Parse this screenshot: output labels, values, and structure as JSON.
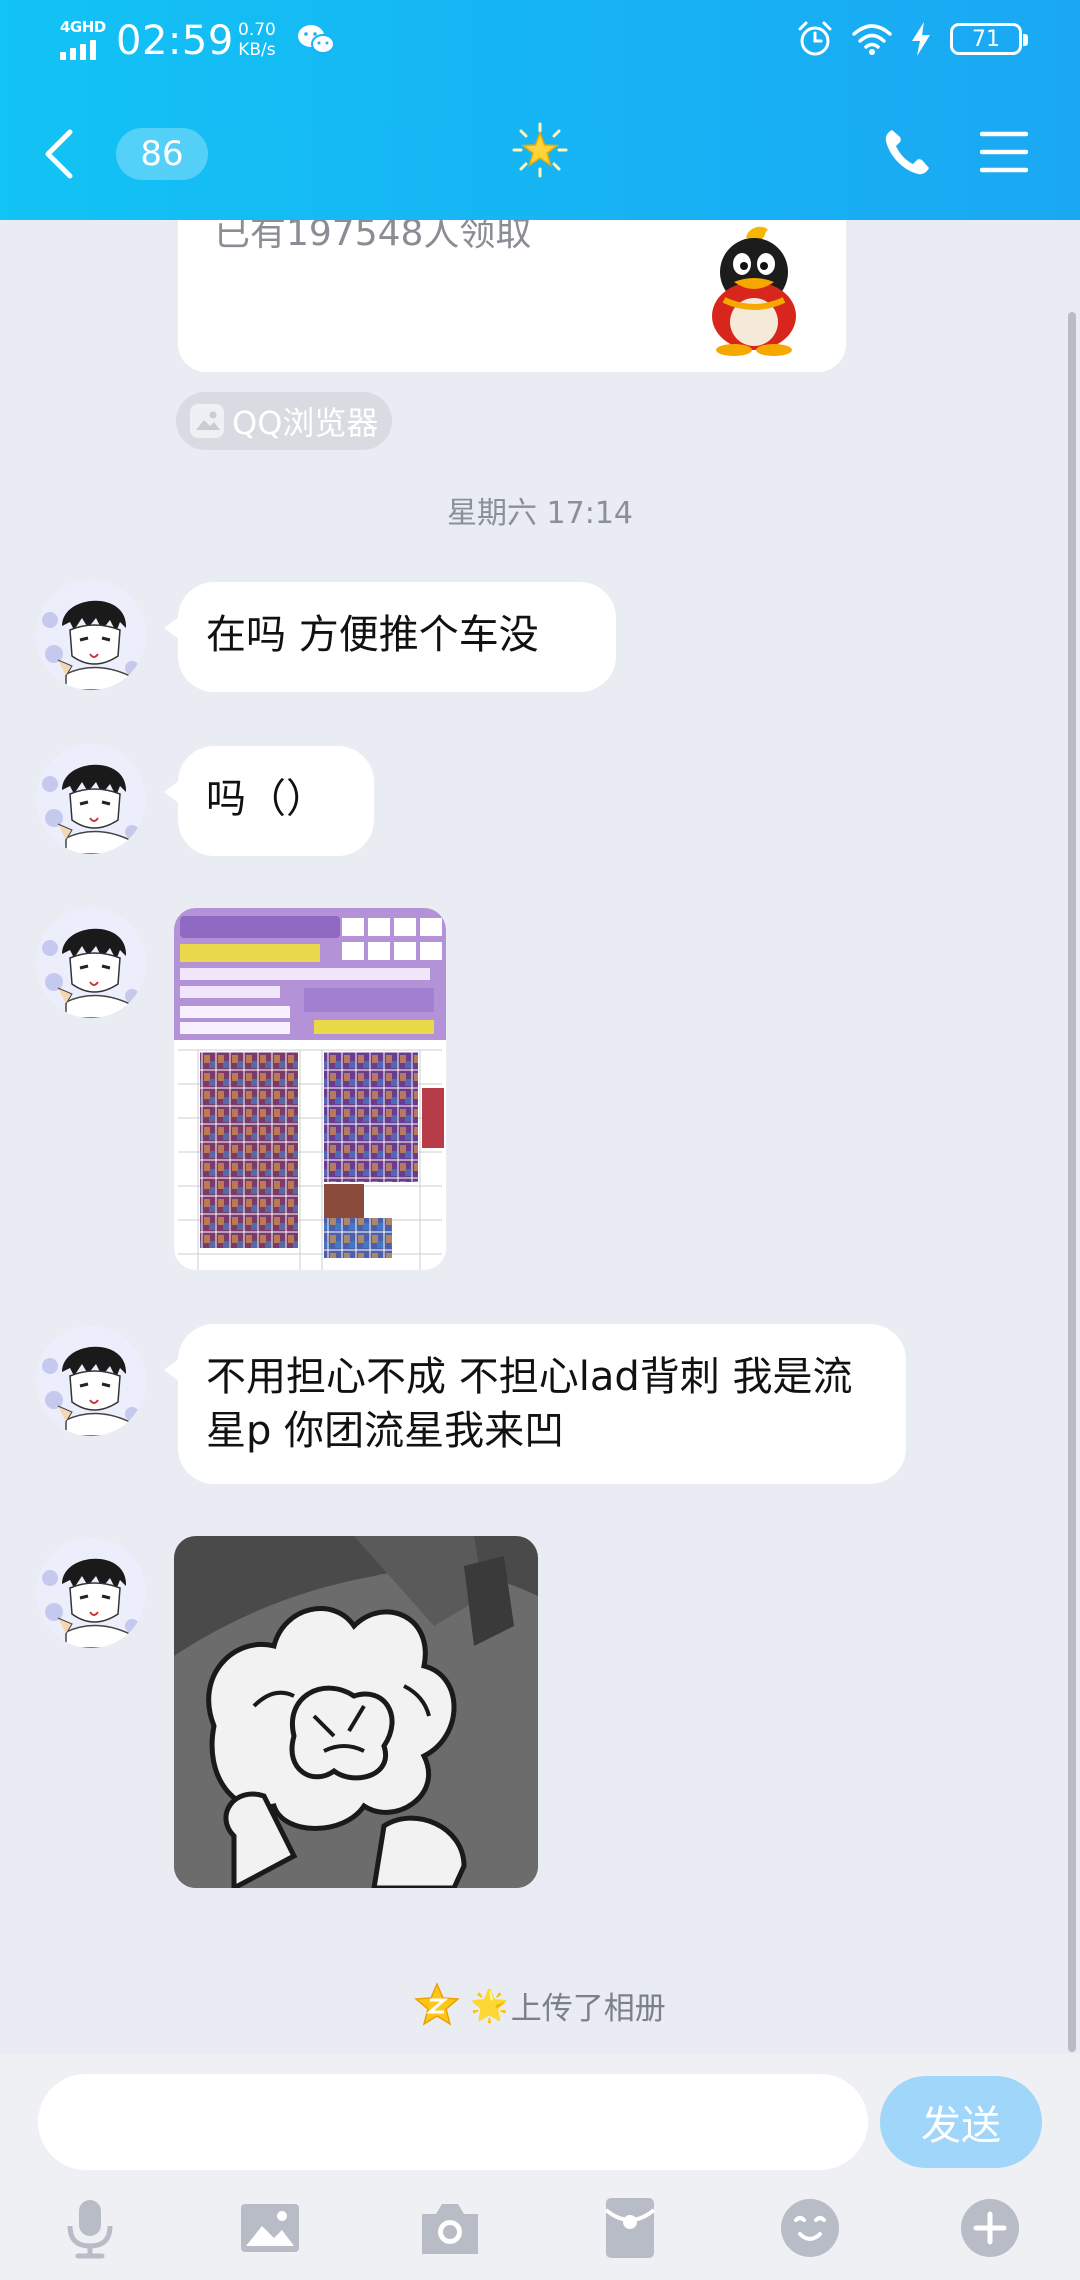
{
  "status_bar": {
    "network": "4GHD",
    "time": "02:59",
    "speed_value": "0.70",
    "speed_unit": "KB/s",
    "battery": "71"
  },
  "navbar": {
    "unread_count": "86",
    "title_icon": "star-emoji"
  },
  "chat": {
    "share_card": {
      "subtitle": "已有197548人领取"
    },
    "source_label": "QQ浏览器",
    "timestamp": "星期六 17:14",
    "messages": [
      {
        "type": "text",
        "text": "在吗 方便推个车没"
      },
      {
        "type": "text",
        "text": "吗（）"
      },
      {
        "type": "image",
        "description_icon": "poster-image"
      },
      {
        "type": "text",
        "text": "不用担心不成 不担心lad背刺 我是流星p 你团流星我来凹"
      },
      {
        "type": "image",
        "description_icon": "sticker-image"
      }
    ],
    "album_notice": {
      "star": "🌟",
      "text": "上传了相册"
    }
  },
  "input": {
    "placeholder": "",
    "send_label": "发送"
  },
  "colors": {
    "header": "#16b6f4",
    "background": "#e9ecf3",
    "send_button": "#9fd6fa",
    "toolbar_icons": "#b8bcc6"
  }
}
